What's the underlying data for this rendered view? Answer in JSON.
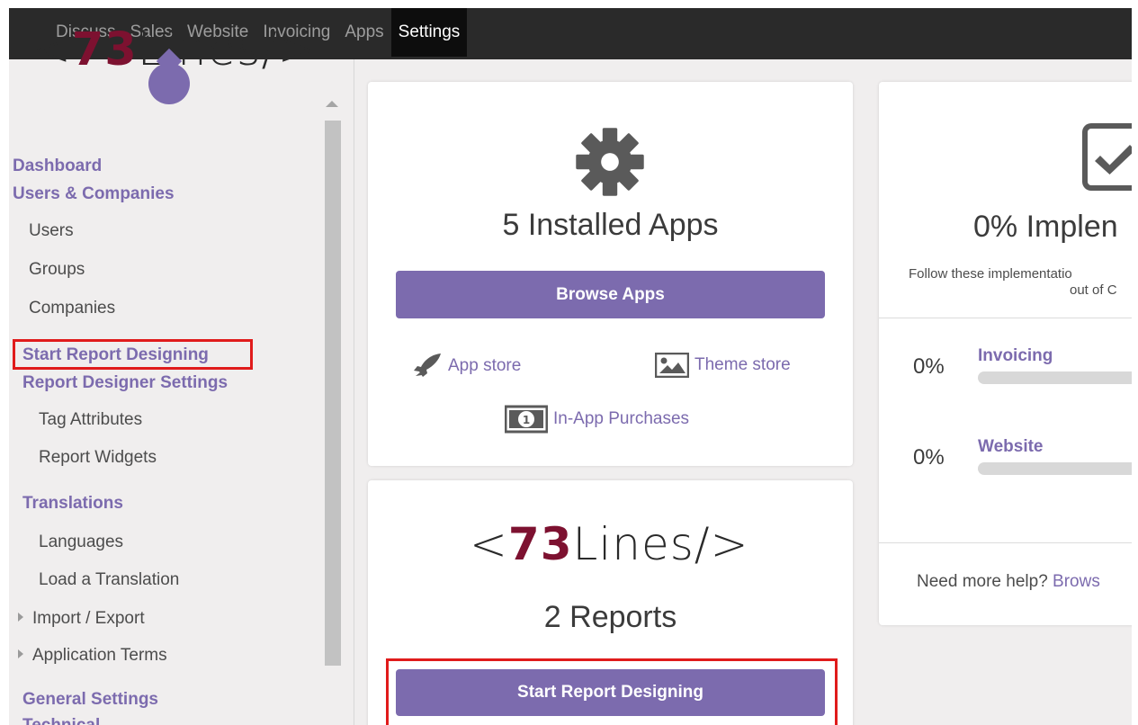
{
  "topbar": {
    "items": [
      "Discuss",
      "Sales",
      "Website",
      "Invoicing",
      "Apps",
      "Settings"
    ],
    "active": "Settings"
  },
  "logo": {
    "prefix": "<",
    "number": "73",
    "suffix": "Lines/>"
  },
  "sidebar": {
    "dashboard": "Dashboard",
    "users_companies": "Users & Companies",
    "users": "Users",
    "groups": "Groups",
    "companies": "Companies",
    "start_report": "Start Report Designing",
    "report_settings": "Report Designer Settings",
    "tag_attributes": "Tag Attributes",
    "report_widgets": "Report Widgets",
    "translations": "Translations",
    "languages": "Languages",
    "load_translation": "Load a Translation",
    "import_export": "Import / Export",
    "application_terms": "Application Terms",
    "general_settings": "General Settings",
    "technical": "Technical"
  },
  "apps_card": {
    "title": "5 Installed Apps",
    "browse_button": "Browse Apps",
    "app_store": "App store",
    "theme_store": "Theme store",
    "in_app": "In-App Purchases"
  },
  "reports_card": {
    "title": "2 Reports",
    "button": "Start Report Designing"
  },
  "impl_card": {
    "title": "0% Implen",
    "desc_line1": "Follow these implementatio",
    "desc_line2": "out of C",
    "items": [
      {
        "pct": "0%",
        "label": "Invoicing",
        "progress": 0
      },
      {
        "pct": "0%",
        "label": "Website",
        "progress": 0
      }
    ],
    "help_text": "Need more help? ",
    "help_link": "Brows"
  },
  "colors": {
    "accent": "#7c6bae",
    "brand_red": "#7d1130",
    "highlight": "#e01b1b",
    "navbar": "#2a2a2a"
  }
}
